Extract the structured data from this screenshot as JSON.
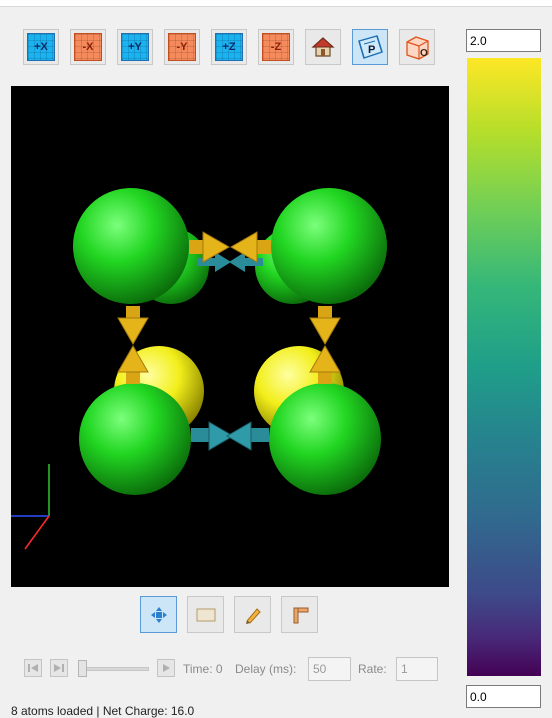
{
  "toolbar": {
    "view_buttons": [
      {
        "label": "+X",
        "kind": "positive"
      },
      {
        "label": "-X",
        "kind": "negative"
      },
      {
        "label": "+Y",
        "kind": "positive"
      },
      {
        "label": "-Y",
        "kind": "negative"
      },
      {
        "label": "+Z",
        "kind": "positive"
      },
      {
        "label": "-Z",
        "kind": "negative"
      }
    ],
    "home_icon": "home-icon",
    "perspective_label": "P",
    "orthographic_label": "O"
  },
  "colors": {
    "positive_fill": "#1ab2f0",
    "positive_border": "#1f6fb5",
    "negative_fill": "#f58a5c",
    "negative_border": "#c24e1e",
    "atom_green": "#22d622",
    "atom_yellow": "#f2ee1a",
    "arrow_gold": "#e4b41a",
    "arrow_teal": "#2a8c99"
  },
  "mode_buttons": [
    "move-icon",
    "select-rect-icon",
    "pencil-icon",
    "measure-icon"
  ],
  "animation": {
    "time_label": "Time: 0",
    "delay_label": "Delay (ms):",
    "delay_value": "50",
    "rate_label": "Rate:",
    "rate_value": "1"
  },
  "status": "8 atoms loaded | Net Charge: 16.0",
  "colorbar": {
    "max_value": "2.0",
    "min_value": "0.0",
    "colormap": "viridis"
  }
}
